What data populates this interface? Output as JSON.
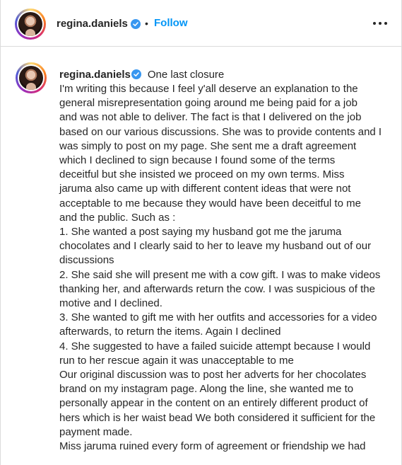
{
  "header": {
    "username": "regina.daniels",
    "separator": "•",
    "follow_label": "Follow"
  },
  "post": {
    "username": "regina.daniels",
    "caption_title": "One last closure",
    "caption_lines": [
      "I'm writing this because I feel y'all deserve an explanation to the",
      "general misrepresentation going around me being paid for a job",
      "and was not able to deliver. The fact is that I delivered on the job",
      "based on our various discussions. She was to provide contents and I",
      "was simply to post on my page. She sent me a draft agreement",
      "which I declined to sign because I found some of the terms",
      "deceitful but she insisted we proceed on my own terms. Miss",
      "jaruma also came up with different content ideas that were not",
      "acceptable to me because they would have been deceitful to me",
      "and the public. Such as :",
      "1. She wanted a post saying my husband got me the jaruma",
      "chocolates and I clearly said to her to leave my husband out of our",
      "discussions",
      "2. She said she will present me with a cow gift. I was to make videos",
      "thanking her, and afterwards return the cow. I was suspicious of the",
      "motive and I declined.",
      "3. She wanted to gift me with her outfits and accessories for a video",
      "afterwards, to return the items. Again I declined",
      "4. She suggested to have a failed suicide attempt because I would",
      "run to her rescue again it was unacceptable to me",
      "Our original discussion was to post her adverts for her chocolates",
      "brand on my instagram page. Along the line, she wanted me to",
      "personally appear in the content on an entirely different product of",
      "hers which is her waist bead We both considered it sufficient for the",
      "payment made.",
      "Miss jaruma ruined every form of agreement or friendship we had"
    ]
  },
  "icons": {
    "verified": "verified-badge-icon",
    "more": "more-options-icon"
  },
  "colors": {
    "accent": "#0095f6",
    "verified": "#3897f0",
    "text": "#262626",
    "border": "#dbdbdb"
  }
}
